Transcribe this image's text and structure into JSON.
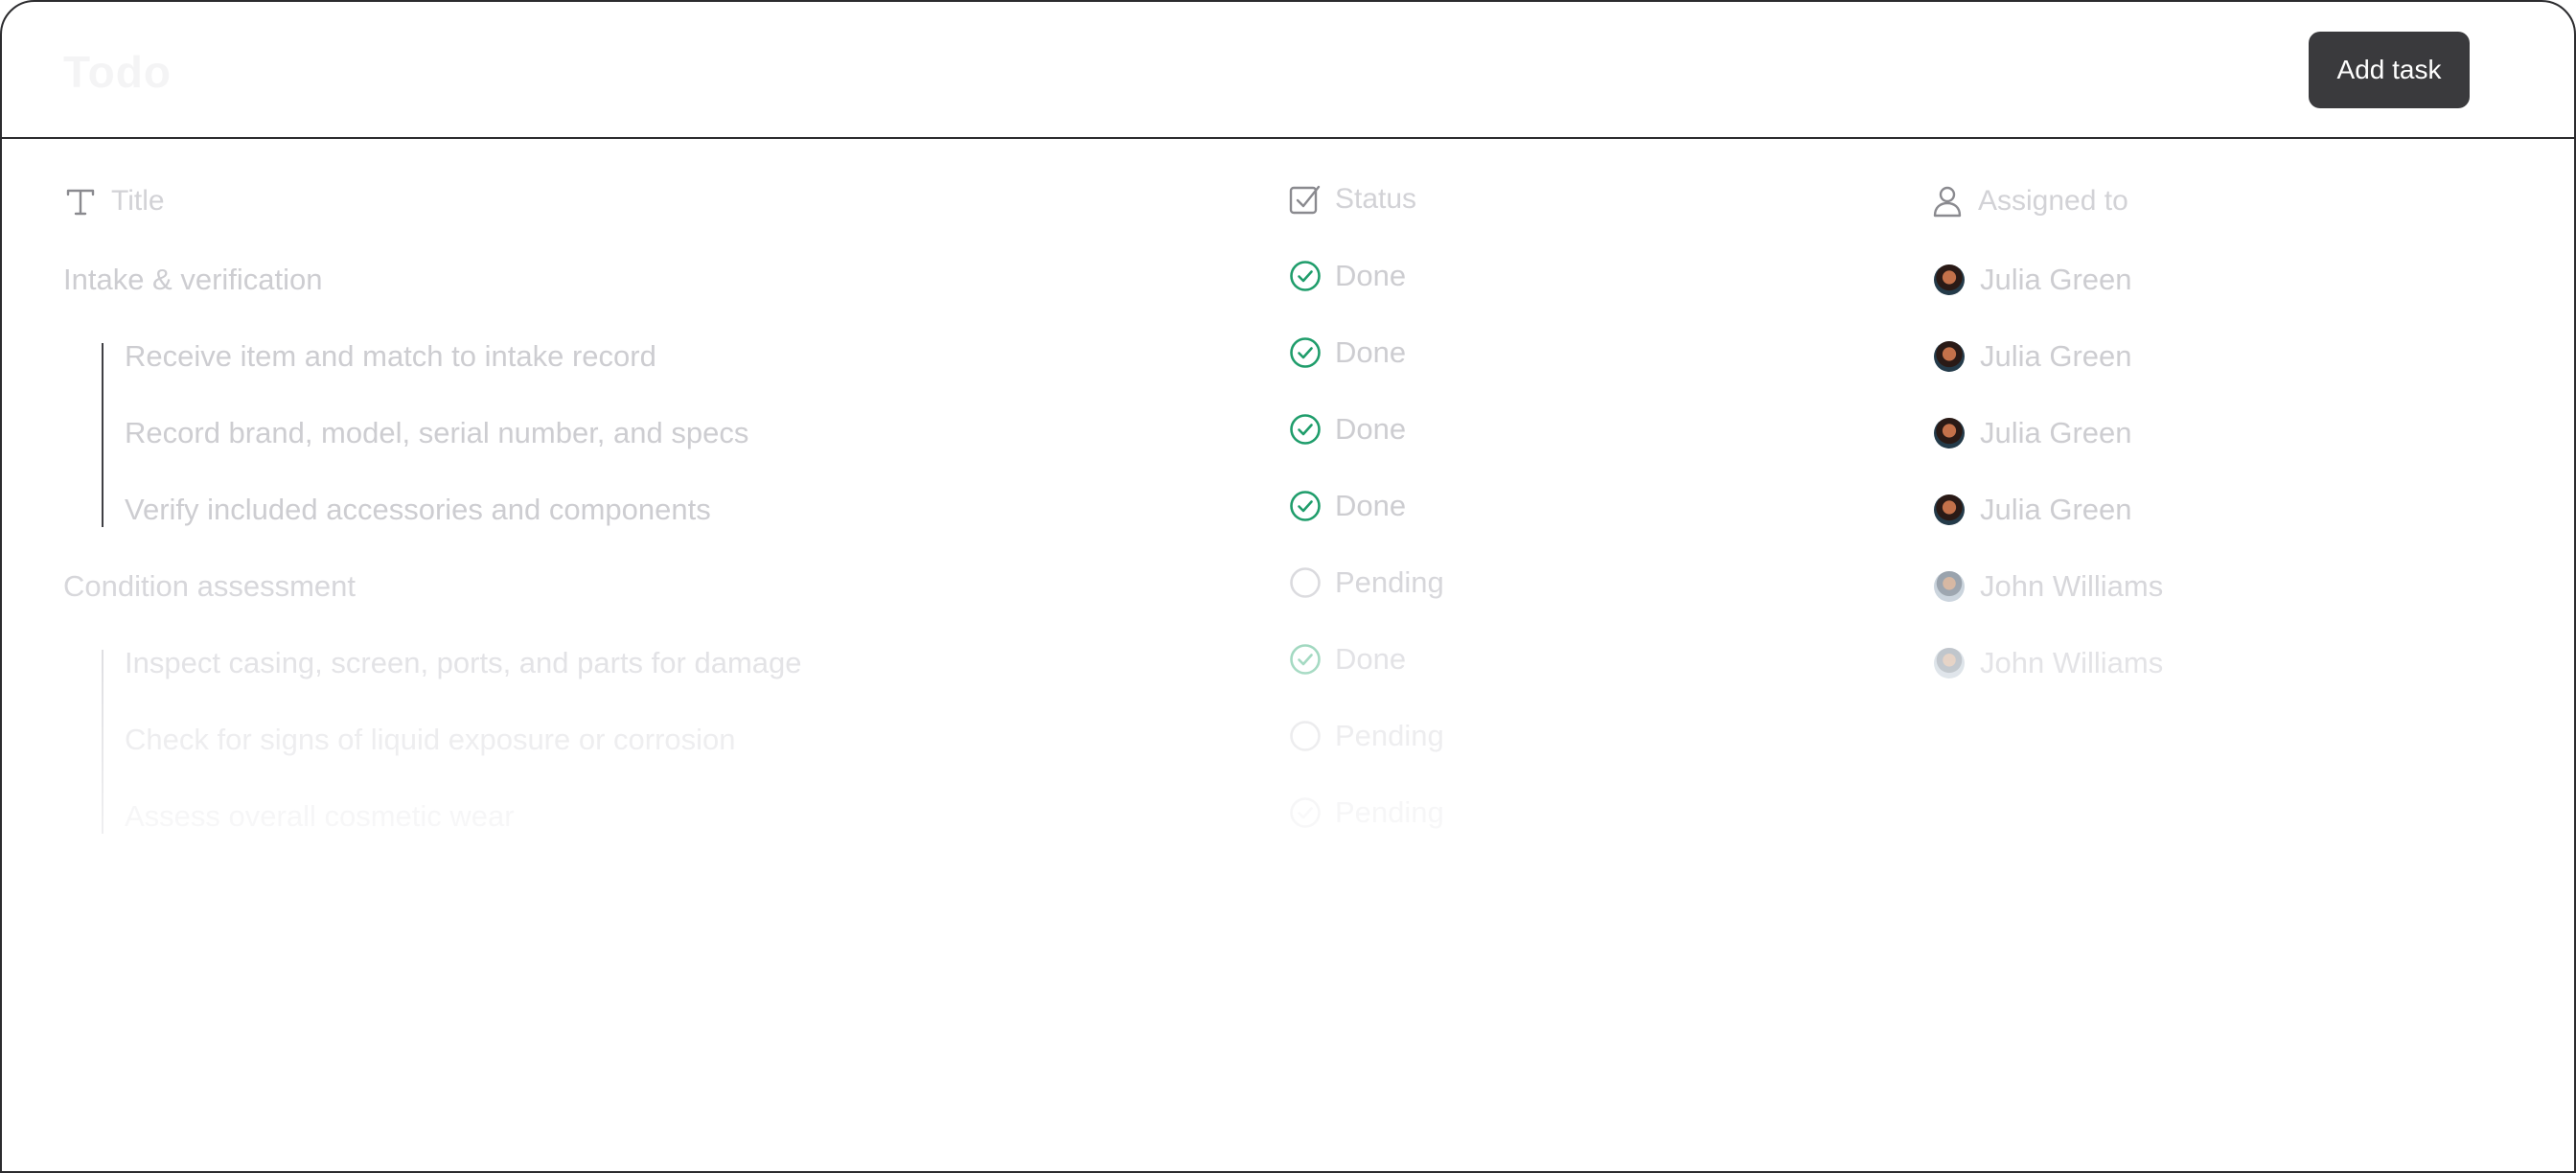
{
  "header": {
    "logo_text": "Todo",
    "add_task_label": "Add task"
  },
  "columns": {
    "title": "Title",
    "status": "Status",
    "assigned": "Assigned to"
  },
  "rows": [
    {
      "title": "Intake & verification",
      "status": "Done",
      "assignee": "Julia Green"
    },
    {
      "title": "Receive item and match to intake record",
      "status": "Done",
      "assignee": "Julia Green"
    },
    {
      "title": "Record brand, model, serial number, and specs",
      "status": "Done",
      "assignee": "Julia Green"
    },
    {
      "title": "Verify included accessories and components",
      "status": "Done",
      "assignee": "Julia Green"
    },
    {
      "title": "Condition assessment",
      "status": "Pending",
      "assignee": "John Williams"
    },
    {
      "title": "Inspect casing, screen, ports, and parts for damage",
      "status": "Done",
      "assignee": "John Williams"
    },
    {
      "title": "Check for signs of liquid exposure or corrosion",
      "status": "Pending",
      "assignee": ""
    },
    {
      "title": "Assess overall cosmetic wear",
      "status": "Pending",
      "assignee": ""
    }
  ],
  "colors": {
    "done": "#1f9d6b",
    "pending": "#d9d9dd",
    "text": "#cdcdd1",
    "button_bg": "#3a3a3d",
    "border": "#2b2b2e"
  }
}
